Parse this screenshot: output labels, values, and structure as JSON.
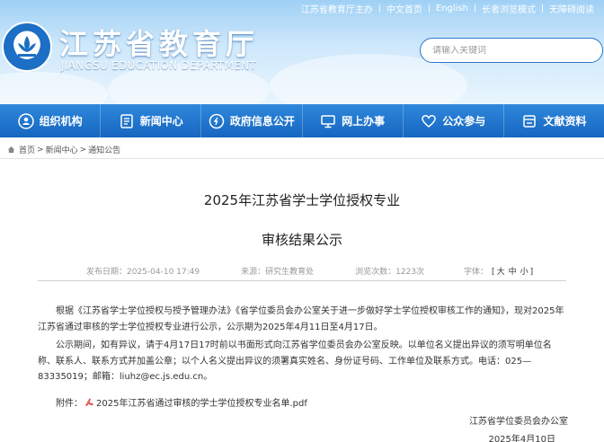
{
  "topbar": {
    "items": [
      "江苏省教育厅主办",
      "中文首页",
      "English",
      "长者浏览模式",
      "无障碍阅读"
    ]
  },
  "header": {
    "title": "江苏省教育厅",
    "subtitle": "JIANGSU EDUCATION DEPARTMENT",
    "search_placeholder": "请输入关键词"
  },
  "nav": {
    "items": [
      {
        "label": "组织机构",
        "icon": "org-icon"
      },
      {
        "label": "新闻中心",
        "icon": "news-icon"
      },
      {
        "label": "政府信息公开",
        "icon": "info-icon"
      },
      {
        "label": "网上办事",
        "icon": "monitor-icon"
      },
      {
        "label": "公众参与",
        "icon": "heart-icon"
      },
      {
        "label": "文献资料",
        "icon": "document-icon"
      }
    ]
  },
  "breadcrumb": {
    "items": [
      "首页",
      "新闻中心",
      "通知公告"
    ],
    "separator": ">"
  },
  "article": {
    "title_line1": "2025年江苏省学士学位授权专业",
    "title_line2": "审核结果公示",
    "meta": {
      "date": "发布日期：2025-04-10 17:49",
      "source": "来源：研究生教育处",
      "views": "浏览次数：1223次",
      "font_label": "字体：",
      "font_sizes": [
        "大",
        "中",
        "小"
      ]
    },
    "paragraph1": "根据《江苏省学士学位授权与授予管理办法》《省学位委员会办公室关于进一步做好学士学位授权审核工作的通知》，现对2025年江苏省通过审核的学士学位授权专业进行公示，公示期为2025年4月11日至4月17日。",
    "paragraph2": "公示期间，如有异议，请于4月17日17时前以书面形式向江苏省学位委员会办公室反映。以单位名义提出异议的须写明单位名称、联系人、联系方式并加盖公章；以个人名义提出异议的须署真实姓名、身份证号码、工作单位及联系方式。电话：025—83335019；邮箱：liuhz@ec.js.edu.cn。",
    "attachment_label": "附件：",
    "attachment_name": "2025年江苏省通过审核的学士学位授权专业名单.pdf",
    "signature": "江苏省学位委员会办公室",
    "sign_date": "2025年4月10日"
  },
  "colors": {
    "nav_blue": "#1a6dc4",
    "header_sky": "#a9d6f7",
    "pdf_red": "#d33"
  }
}
